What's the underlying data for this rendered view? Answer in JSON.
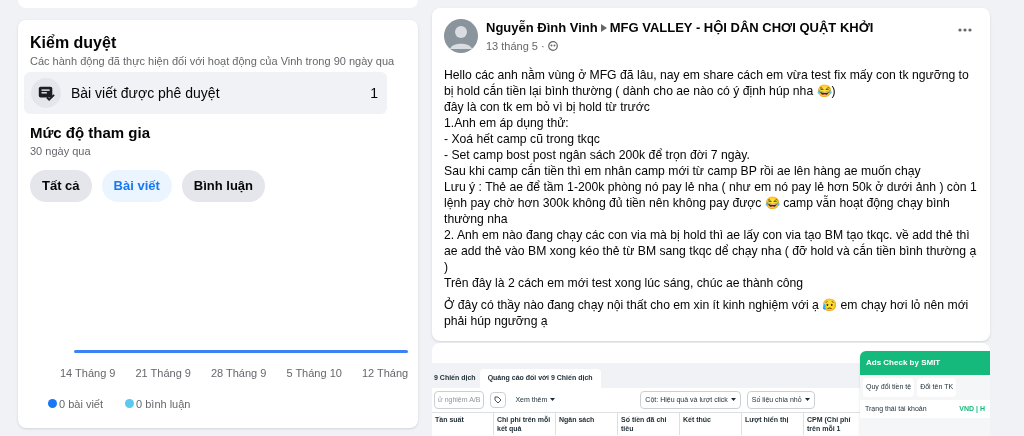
{
  "moderation": {
    "title": "Kiểm duyệt",
    "subtitle": "Các hành động đã thực hiện đối với hoạt động của Vinh trong 90 ngày qua",
    "items": [
      {
        "label": "Bài viết được phê duyệt",
        "count": "1"
      }
    ]
  },
  "engagement": {
    "title": "Mức độ tham gia",
    "subtitle": "30 ngày qua",
    "filters": [
      {
        "label": "Tất cả",
        "selected": false
      },
      {
        "label": "Bài viết",
        "selected": true
      },
      {
        "label": "Bình luận",
        "selected": false
      }
    ],
    "x_labels": [
      "14 Tháng 9",
      "21 Tháng 9",
      "28 Tháng 9",
      "5 Tháng 10",
      "12 Tháng"
    ],
    "legend": [
      {
        "label": "0 bài viết",
        "color": "#1877f2"
      },
      {
        "label": "0 bình luận",
        "color": "#5bc8f0"
      }
    ]
  },
  "post": {
    "author": "Nguyễn Đình Vinh",
    "group": "MFG VALLEY - HỘI DÂN CHƠI QUẬT KHỞI",
    "date": "13 tháng 5 ·",
    "paragraphs": [
      "Hello các anh nằm vùng ở MFG đã lâu, nay em share cách em vừa test fix mấy con tk ngưỡng to bị hold cắn tiền lại bình thường ( dành cho ae nào có ý định húp nha 😂)\nđây là con tk em bỏ vì bị hold từ trước\n1.Anh em áp dụng thử:\n- Xoá hết camp cũ trong tkqc\n- Set camp bost post ngân sách 200k để trọn đời 7 ngày.\nSau khi camp cắn tiền thì em nhân camp mới từ camp BP rồi ae lên hàng ae muốn chạy\nLưu ý : Thẻ ae để tầm 1-200k phòng nó pay lẻ nha ( như em nó pay lẻ hơn 50k ở dưới ảnh ) còn 1 lệnh pay chờ hơn 300k không đủ tiền nên không pay được 😂 camp vẫn hoạt động chạy bình thường nha\n2. Anh em nào đang chạy các con via mà bị hold thì ae lấy con via tạo BM tạo tkqc. về add thẻ thì ae add thẻ vào BM xong kéo thẻ từ BM sang tkqc dể chạy nha ( đỡ hold và cắn tiền bình thường ạ )\nTrên đây là 2 cách em mới test xong lúc sáng, chúc ae thành công",
      "Ở đây có thầy nào đang chạy nội thất cho em xin ít kinh nghiệm với ạ 😥 em chạy hơi lỏ nên mới phải húp ngưỡng ạ"
    ]
  },
  "screenshot": {
    "tabs": [
      {
        "label": "9 Chiến dịch",
        "selected": false
      },
      {
        "label": "Quảng cáo đối với 9 Chiến dịch",
        "selected": true
      }
    ],
    "search_value": "ử nghiệm A/B",
    "more": "Xem thêm",
    "columns_button": "Cột: Hiệu quả và lượt click",
    "breakdown_button": "Số liệu chia nhỏ",
    "columns": [
      "Tần suất",
      "Chi phí trên mỗi kết quả",
      "Ngân sách",
      "Số tiền đã chi tiêu",
      "Kết thúc",
      "Lượt hiển thị",
      "CPM (Chi phí trên mỗi 1"
    ],
    "extension": {
      "title": "Ads Check by SMIT",
      "buttons": [
        "Quy đổi tiền tệ",
        "Đổi tên TK"
      ],
      "status_label": "Trạng thái tài khoản",
      "status_value": "VND | H"
    }
  }
}
